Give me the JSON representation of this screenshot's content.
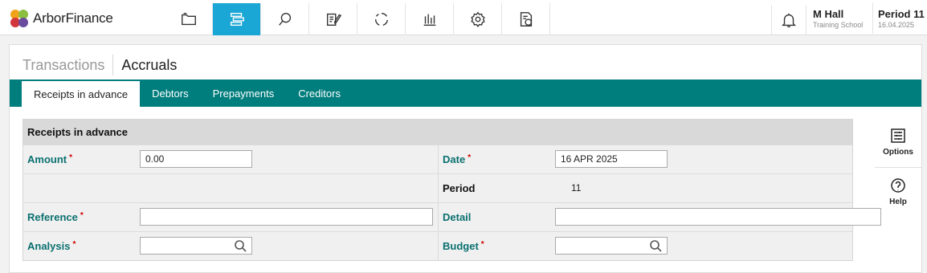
{
  "app": {
    "name": "ArborFinance"
  },
  "nav": {
    "items": [
      {
        "icon": "folder-icon",
        "active": false
      },
      {
        "icon": "list-tree-icon",
        "active": true
      },
      {
        "icon": "search-icon",
        "active": false
      },
      {
        "icon": "edit-document-icon",
        "active": false
      },
      {
        "icon": "refresh-cycle-icon",
        "active": false
      },
      {
        "icon": "bar-chart-icon",
        "active": false
      },
      {
        "icon": "gear-icon",
        "active": false
      },
      {
        "icon": "pound-document-icon",
        "active": false
      }
    ],
    "active_color": "#1ba7d5"
  },
  "user": {
    "name": "M Hall",
    "school": "Training School"
  },
  "period": {
    "label": "Period 11",
    "date": "16.04.2025"
  },
  "breadcrumb": {
    "root": "Transactions",
    "current": "Accruals"
  },
  "tabs": [
    {
      "label": "Receipts in advance",
      "active": true
    },
    {
      "label": "Debtors",
      "active": false
    },
    {
      "label": "Prepayments",
      "active": false
    },
    {
      "label": "Creditors",
      "active": false
    }
  ],
  "tab_bar_color": "#007d7d",
  "form": {
    "title": "Receipts in advance",
    "amount": {
      "label": "Amount",
      "required": "*",
      "value": "0.00"
    },
    "date": {
      "label": "Date",
      "required": "*",
      "value": "16 APR 2025"
    },
    "period": {
      "label": "Period",
      "value": "11"
    },
    "reference": {
      "label": "Reference",
      "required": "*",
      "value": ""
    },
    "detail": {
      "label": "Detail",
      "value": ""
    },
    "analysis": {
      "label": "Analysis",
      "required": "*",
      "value": ""
    },
    "budget": {
      "label": "Budget",
      "required": "*",
      "value": ""
    }
  },
  "side": {
    "options_label": "Options",
    "help_label": "Help"
  }
}
